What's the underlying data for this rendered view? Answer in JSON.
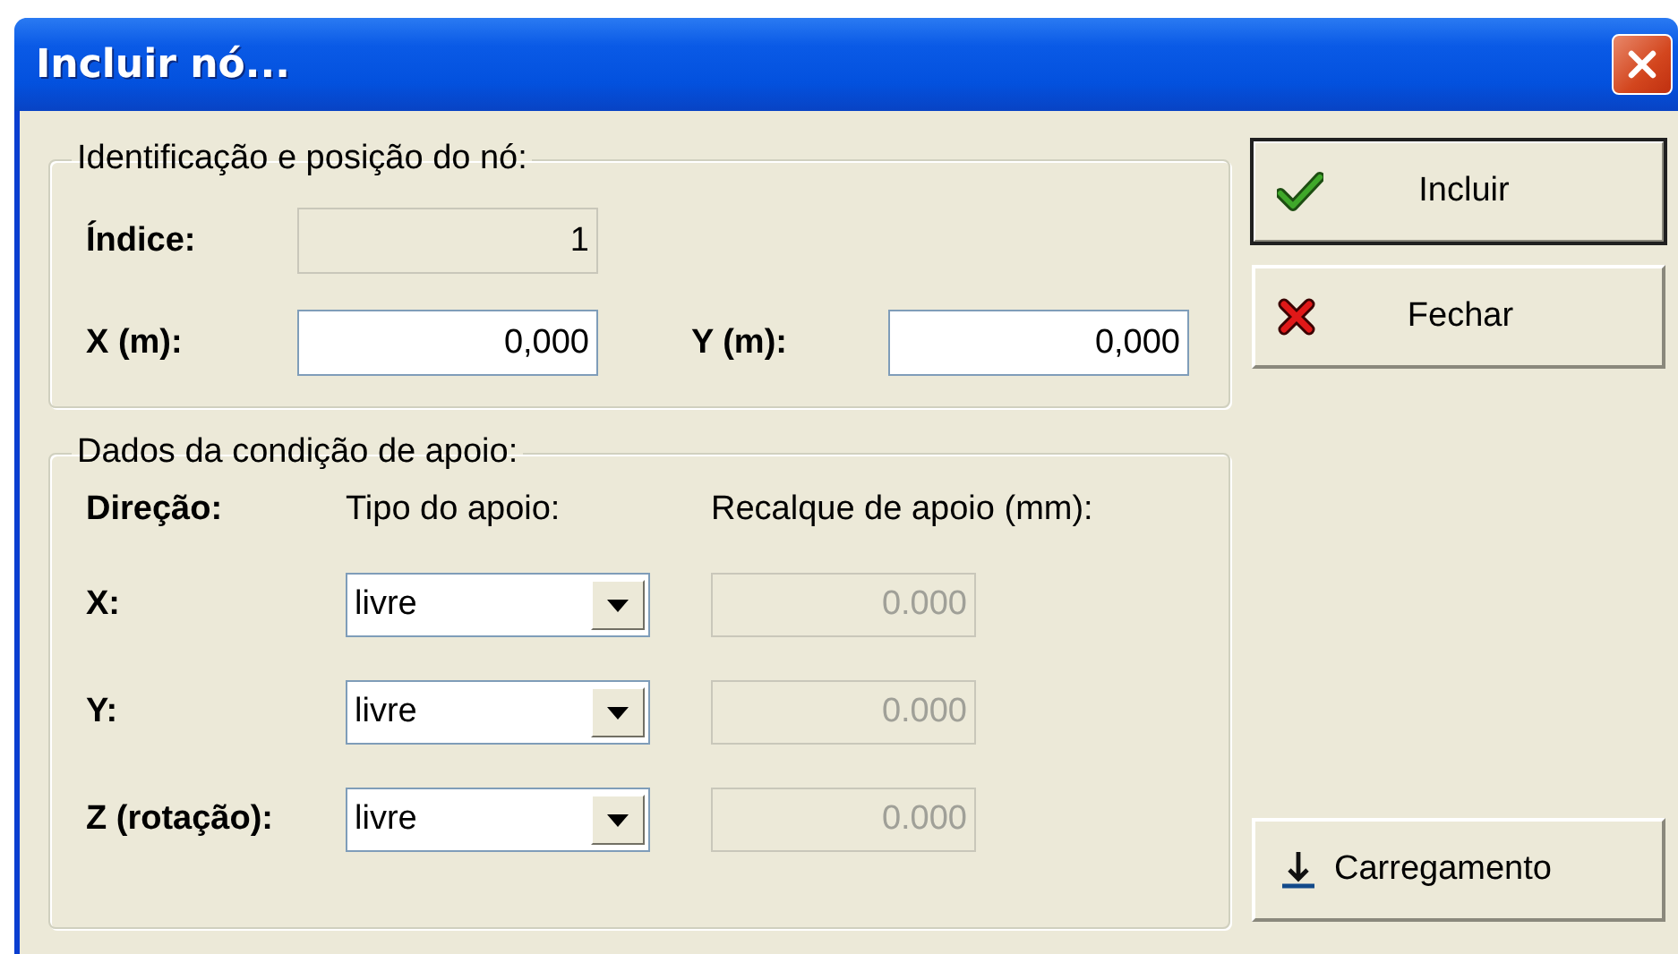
{
  "window": {
    "title": "Incluir nó..."
  },
  "position_group": {
    "legend": "Identificação e posição do nó:",
    "index": {
      "label": "Índice:",
      "value": "1",
      "disabled": true
    },
    "x": {
      "label": "X (m):",
      "value": "0,000",
      "disabled": false
    },
    "y": {
      "label": "Y (m):",
      "value": "0,000",
      "disabled": false
    }
  },
  "support_group": {
    "legend": "Dados da condição de apoio:",
    "headers": [
      "Direção:",
      "Tipo do apoio:",
      "Recalque de apoio (mm):"
    ],
    "rows": [
      {
        "label": "X:",
        "type": "livre",
        "settlement": "0.000",
        "disabled": true
      },
      {
        "label": "Y:",
        "type": "livre",
        "settlement": "0.000",
        "disabled": true
      },
      {
        "label": "Z (rotação):",
        "type": "livre",
        "settlement": "0.000",
        "disabled": true
      }
    ]
  },
  "buttons": [
    {
      "label": "Incluir",
      "kind": "include",
      "default": true
    },
    {
      "label": "Fechar",
      "kind": "close",
      "default": false
    },
    {
      "label": "Carregamento",
      "kind": "load",
      "default": false
    }
  ]
}
